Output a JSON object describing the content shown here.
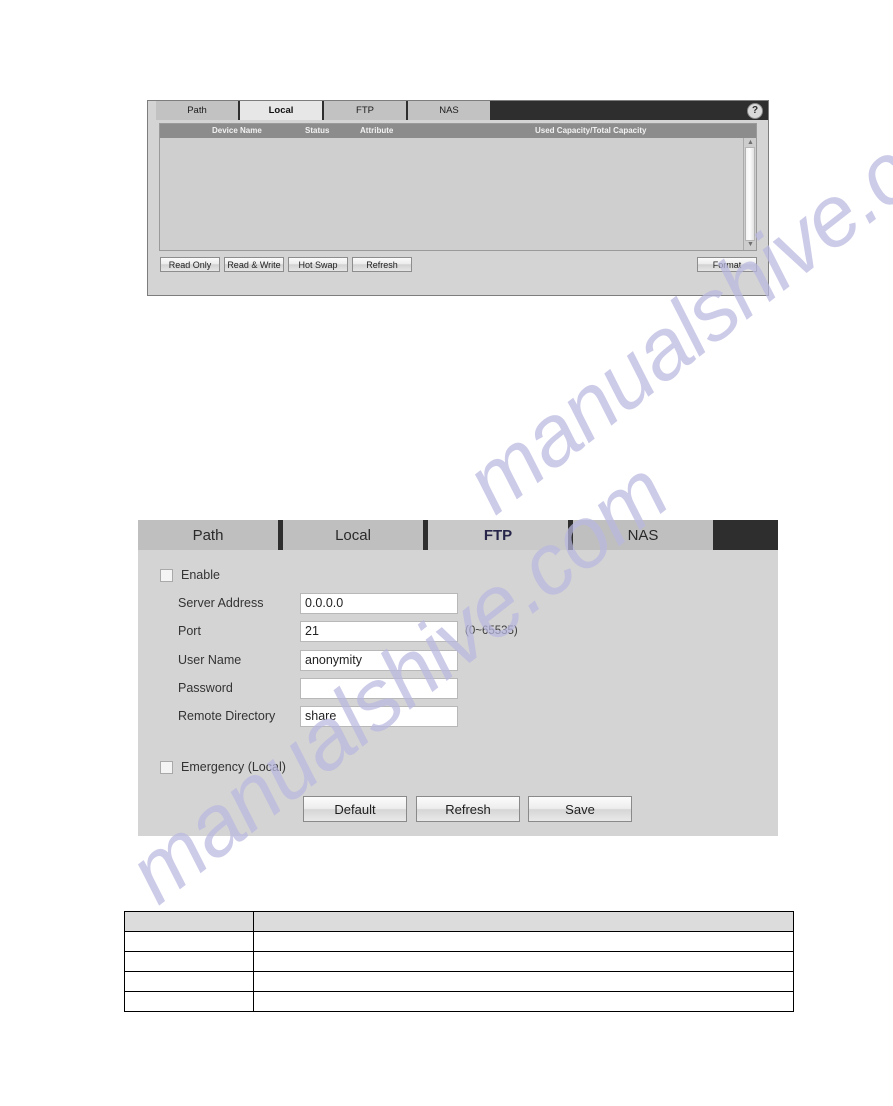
{
  "panel_local": {
    "tabs": [
      {
        "label": "Path",
        "active": false
      },
      {
        "label": "Local",
        "active": true
      },
      {
        "label": "FTP",
        "active": false
      },
      {
        "label": "NAS",
        "active": false
      }
    ],
    "help_icon": "help-icon",
    "help_glyph": "?",
    "table": {
      "columns": [
        "Device Name",
        "Status",
        "Attribute",
        "Used Capacity/Total Capacity"
      ],
      "rows": []
    },
    "buttons": [
      {
        "label": "Read Only"
      },
      {
        "label": "Read & Write"
      },
      {
        "label": "Hot Swap"
      },
      {
        "label": "Refresh"
      }
    ],
    "format_button": "Format",
    "scrollbar": {
      "up_glyph": "▲",
      "down_glyph": "▼"
    }
  },
  "panel_ftp": {
    "tabs": [
      {
        "label": "Path",
        "active": false
      },
      {
        "label": "Local",
        "active": false
      },
      {
        "label": "FTP",
        "active": true
      },
      {
        "label": "NAS",
        "active": false
      }
    ],
    "enable": {
      "label": "Enable",
      "checked": false
    },
    "fields": [
      {
        "label": "Server Address",
        "value": "0.0.0.0",
        "hint": ""
      },
      {
        "label": "Port",
        "value": "21",
        "hint": "(0~65535)"
      },
      {
        "label": "User Name",
        "value": "anonymity",
        "hint": ""
      },
      {
        "label": "Password",
        "value": "",
        "hint": ""
      },
      {
        "label": "Remote Directory",
        "value": "share",
        "hint": ""
      }
    ],
    "emergency": {
      "label": "Emergency (Local)",
      "checked": false
    },
    "buttons": [
      {
        "label": "Default"
      },
      {
        "label": "Refresh"
      },
      {
        "label": "Save"
      }
    ]
  },
  "bottom_table": {
    "header": [
      "",
      ""
    ],
    "rows": [
      [
        "",
        ""
      ],
      [
        "",
        ""
      ],
      [
        "",
        ""
      ],
      [
        "",
        ""
      ]
    ]
  },
  "watermark": {
    "text": "manualshive.com",
    "color": "#b9b8e0"
  }
}
